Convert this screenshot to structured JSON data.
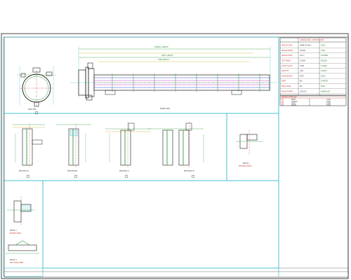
{
  "colors": {
    "border": "#1a1a1a",
    "cyan": "#22b8c8",
    "green": "#2e9e3a",
    "red": "#d23a2e",
    "yellow": "#c9b21e",
    "magenta": "#c23ab8",
    "blue": "#2a4ad8"
  },
  "labels": {
    "top_view": "FRONT VIEW",
    "side_view": "SIDE VIEW",
    "section_a": "SECTION A-A",
    "section_b": "SECTION B-B",
    "section_c": "SECTION C-C",
    "section_d": "SECTION D-D",
    "detail_1": "DETAIL 1",
    "detail_1_sub": "WELDING DETAIL",
    "detail_2": "DETAIL 2",
    "detail_2_sub": "NOZZLE WELD",
    "detail_3": "DETAIL 3",
    "detail_3_sub": "BUTT WELD PREP",
    "dim_overall": "OVERALL LENGTH",
    "dim_tube": "TUBE LENGTH",
    "dim_shell": "SHELL LENGTH"
  },
  "title_block": {
    "header": "DESIGN DATA / SPECIFICATION",
    "rows": [
      [
        "DESIGN CODE",
        "ASME VIII DIV.1",
        "SHELL"
      ],
      [
        "DESIGN PRESS.",
        "10 BAR",
        "TUBE"
      ],
      [
        "DESIGN TEMP.",
        "150 C",
        "CHANNEL"
      ],
      [
        "TEST PRESS.",
        "15 BAR",
        "NOZZLE"
      ],
      [
        "CORR. ALLOW.",
        "3 MM",
        "FLANGE"
      ],
      [
        "JOINT EFF.",
        "0.85",
        "GASKET"
      ],
      [
        "RADIOGRAPHY",
        "SPOT",
        "BOLTS"
      ],
      [
        "PWHT",
        "NO",
        "SUPPORT"
      ],
      [
        "INSULATION",
        "NO",
        "PAINT"
      ],
      [
        "WEIGHT EMPTY",
        "1200 KG",
        "NAMEPLATE"
      ]
    ],
    "nozzle_header": "NOZZLE SCHEDULE",
    "nozzle_rows": [
      [
        "N1",
        "INLET",
        "4\"",
        "150#"
      ],
      [
        "N2",
        "OUTLET",
        "4\"",
        "150#"
      ],
      [
        "N3",
        "VENT",
        "1\"",
        "150#"
      ],
      [
        "N4",
        "DRAIN",
        "1\"",
        "150#"
      ]
    ]
  }
}
